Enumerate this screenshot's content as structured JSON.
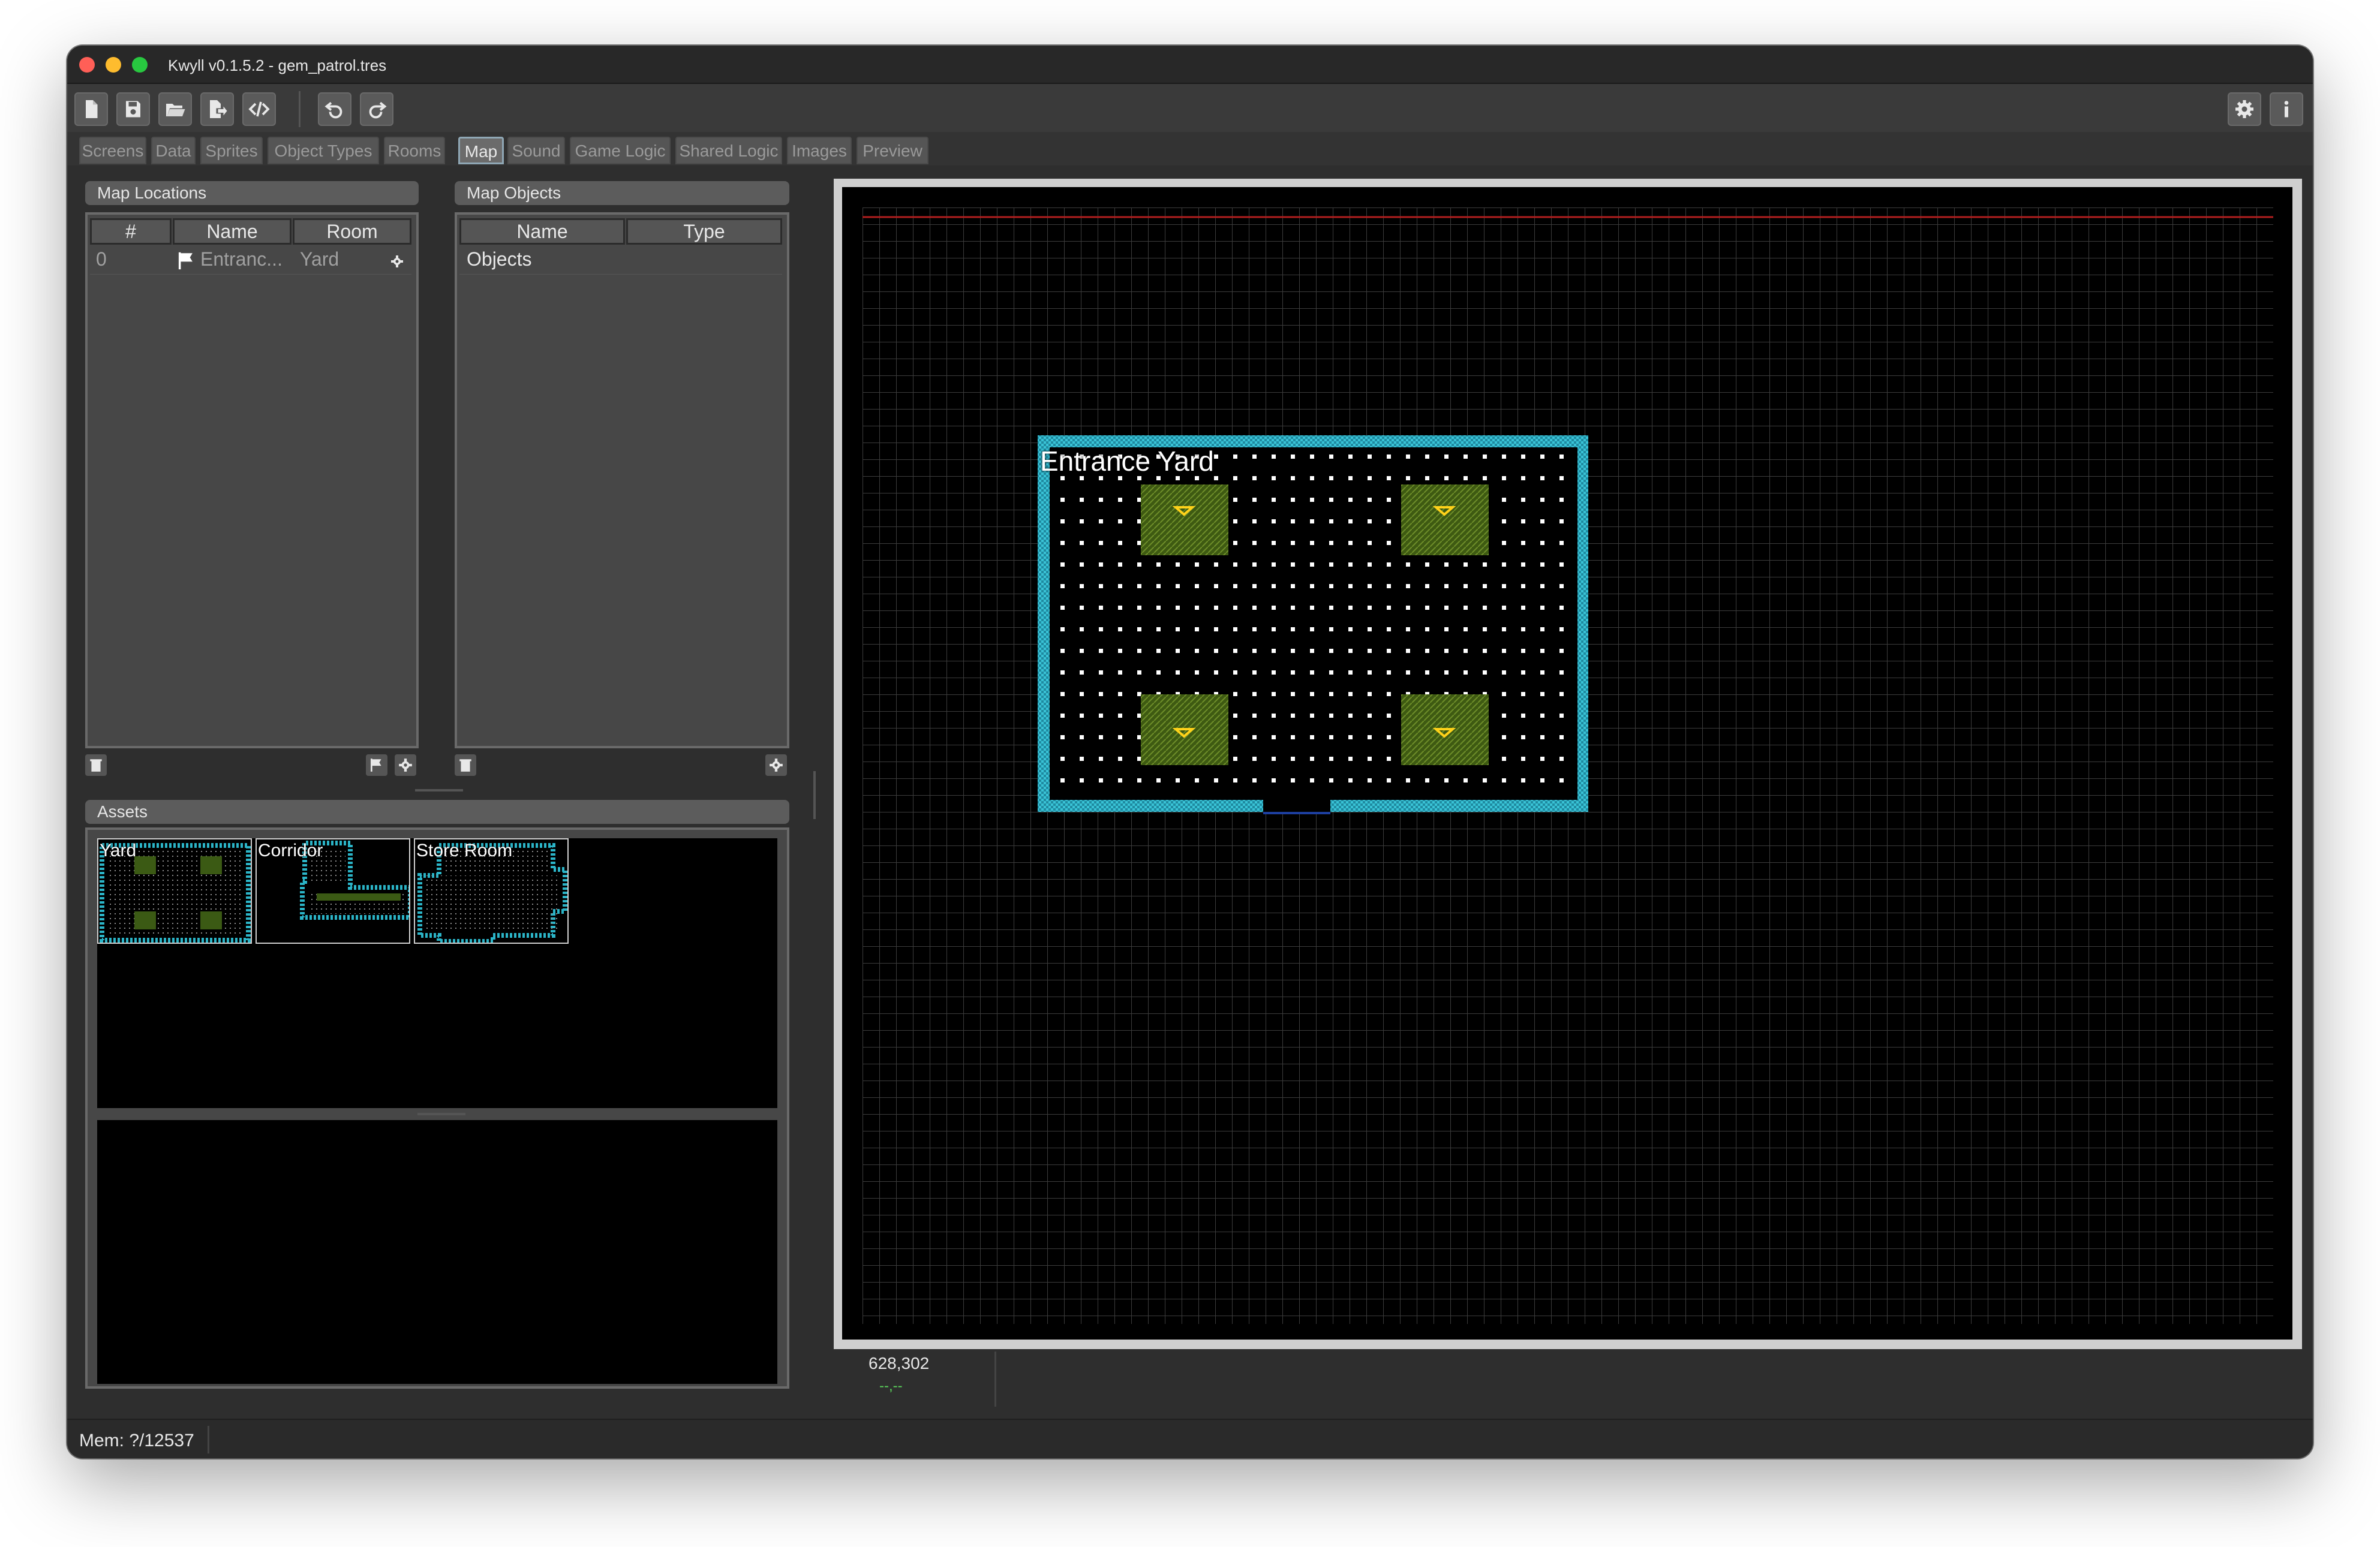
{
  "window": {
    "title": "Kwyll v0.1.5.2 - gem_patrol.tres"
  },
  "toolbar": {
    "buttons": [
      "new-file",
      "save",
      "open-folder",
      "export",
      "code",
      "undo",
      "redo"
    ],
    "right_buttons": [
      "settings",
      "info"
    ]
  },
  "tabs": [
    "Screens",
    "Data",
    "Sprites",
    "Object Types",
    "Rooms",
    "Map",
    "Sound",
    "Game Logic",
    "Shared Logic",
    "Images",
    "Preview"
  ],
  "active_tab": "Map",
  "map_locations": {
    "title": "Map Locations",
    "columns": [
      "#",
      "Name",
      "Room"
    ],
    "rows": [
      {
        "index": "0",
        "name": "Entranc...",
        "room": "Yard"
      }
    ]
  },
  "map_objects": {
    "title": "Map Objects",
    "columns": [
      "Name",
      "Type"
    ],
    "rows": [
      {
        "name": "Objects",
        "type": ""
      }
    ]
  },
  "assets": {
    "title": "Assets",
    "items": [
      "Yard",
      "Corridor",
      "Store Room"
    ]
  },
  "map": {
    "room_label": "Entrance Yard",
    "cursor_coords": "628,302",
    "selection_coords": "--,--"
  },
  "status": {
    "memory": "Mem: ?/12537"
  },
  "colors": {
    "accent_tab_border": "#8fa7b5",
    "room_wall": "#2bb5c8",
    "floor_patch": "#5a7a1a",
    "gem": "#ffd21a",
    "boundary_line": "#b01e1e",
    "coords_green": "#5bd65b"
  }
}
